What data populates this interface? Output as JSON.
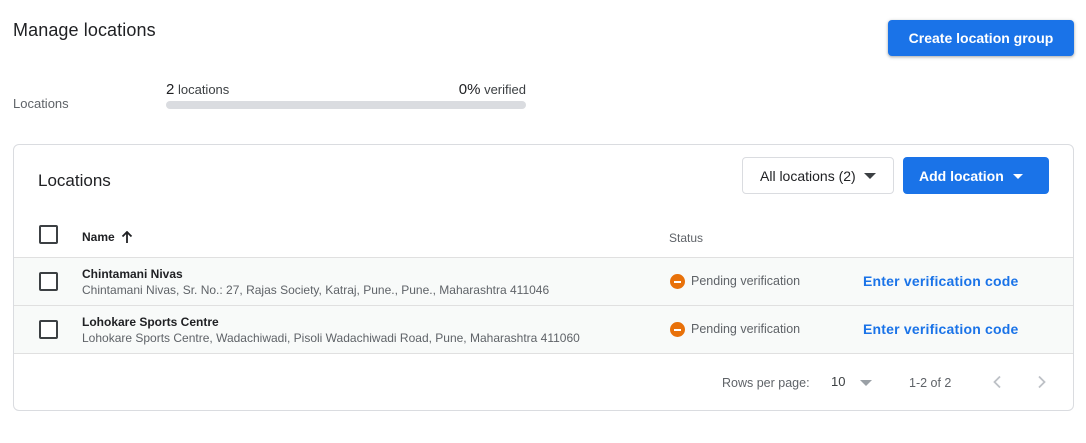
{
  "header": {
    "title": "Manage locations",
    "create_group_label": "Create location group"
  },
  "summary": {
    "label": "Locations",
    "count_value": "2",
    "count_suffix": "locations",
    "verified_value": "0%",
    "verified_suffix": "verified",
    "verified_fraction": 0
  },
  "locations_card": {
    "title": "Locations",
    "filter": {
      "selected": "All locations (2)",
      "icon": "caret-down-icon"
    },
    "add_location_label": "Add location",
    "columns": {
      "name": "Name",
      "name_sort_icon": "arrow-up-icon",
      "status": "Status"
    },
    "rows": [
      {
        "name": "Chintamani Nivas",
        "address": "Chintamani Nivas, Sr. No.: 27, Rajas Society, Katraj, Pune., Pune., Maharashtra 411046",
        "status": "Pending verification",
        "action": "Enter verification code"
      },
      {
        "name": "Lohokare Sports Centre",
        "address": "Lohokare Sports Centre, Wadachiwadi, Pisoli Wadachiwadi Road, Pune, Maharashtra 411060",
        "status": "Pending verification",
        "action": "Enter verification code"
      }
    ],
    "pagination": {
      "rows_per_page_label": "Rows per page:",
      "rows_per_page_value": "10",
      "range": "1-2 of 2",
      "prev_icon": "chevron-left-icon",
      "next_icon": "chevron-right-icon"
    }
  },
  "colors": {
    "accent": "#1a73e8",
    "pending": "#e8710a",
    "row_background": "#f8faf9"
  }
}
